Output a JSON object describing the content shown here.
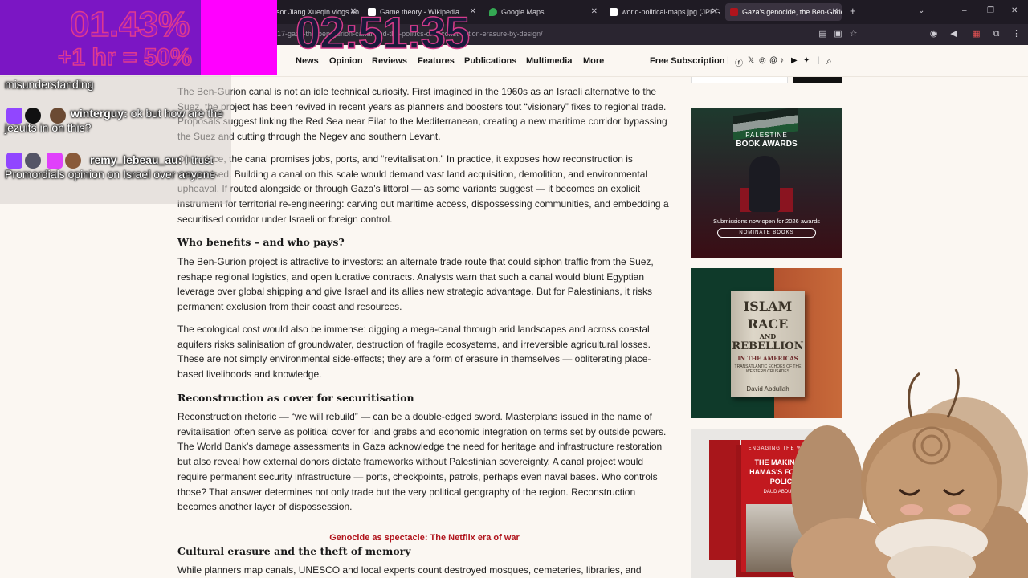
{
  "browser": {
    "tabs": [
      {
        "title": "sor Jiang Xueqin vlogs ab",
        "active": false,
        "fav_color": "#cc2222"
      },
      {
        "title": "Game theory - Wikipedia",
        "active": false,
        "fav_color": "#ffffff"
      },
      {
        "title": "Google Maps",
        "active": false,
        "fav_color": "#34a853"
      },
      {
        "title": "world-political-maps.jpg (JPEG",
        "active": false,
        "fav_color": "#ffffff"
      },
      {
        "title": "Gaza's genocide, the Ben-Gurio",
        "active": true,
        "fav_color": "#b0141c"
      }
    ],
    "url": "917-gaza-the-ben-gurion-canal-and-the-politics-of-reconstruction-erasure-by-design/",
    "new_tab_icon": "plus-icon"
  },
  "site_nav": {
    "links": [
      "News",
      "Opinion",
      "Reviews",
      "Features",
      "Publications",
      "Multimedia",
      "More"
    ],
    "subscription": "Free Subscription",
    "social_icons": [
      "facebook-icon",
      "x-icon",
      "instagram-icon",
      "threads-icon",
      "tiktok-icon",
      "youtube-icon",
      "bluesky-icon"
    ]
  },
  "article": {
    "p1": "The Ben-Gurion canal is not an idle technical curiosity. First imagined in the 1960s as an Israeli alternative to the Suez, the project has been revived in recent years as planners and boosters tout “visionary” fixes to regional trade. Proposals suggest linking the Red Sea near Eilat to the Mediterranean, creating a new maritime corridor bypassing the Suez and cutting through the Negev and southern Levant.",
    "p2": "On its face, the canal promises jobs, ports, and “revitalisation.” In practice, it exposes how reconstruction is weaponised. Building a canal on this scale would demand vast land acquisition, demolition, and environmental upheaval. If routed alongside or through Gaza’s littoral — as some variants suggest — it becomes an explicit instrument for territorial re-engineering: carving out maritime access, dispossessing communities, and embedding a securitised corridor under Israeli or foreign control.",
    "h1": "Who benefits – and who pays?",
    "p3": "The Ben-Gurion project is attractive to investors: an alternate trade route that could siphon traffic from the Suez, reshape regional logistics, and open lucrative contracts. Analysts warn that such a canal would blunt Egyptian leverage over global shipping and give Israel and its allies new strategic advantage. But for Palestinians, it risks permanent exclusion from their coast and resources.",
    "p4": "The ecological cost would also be immense: digging a mega-canal through arid landscapes and across coastal aquifers risks salinisation of groundwater, destruction of fragile ecosystems, and irreversible agricultural losses. These are not simply environmental side-effects; they are a form of erasure in themselves — obliterating place-based livelihoods and knowledge.",
    "h2": "Reconstruction as cover for securitisation",
    "p5": "Reconstruction rhetoric — “we will rebuild” — can be a double-edged sword. Masterplans issued in the name of revitalisation often serve as political cover for land grabs and economic integration on terms set by outside powers. The World Bank’s damage assessments in Gaza acknowledge the need for heritage and infrastructure restoration but also reveal how external donors dictate frameworks without Palestinian sovereignty. A canal project would require permanent security infrastructure — ports, checkpoints, patrols, perhaps even naval bases. Who controls those? That answer determines not only trade but the very political geography of the region. Reconstruction becomes another layer of dispossession.",
    "related": "Genocide as spectacle: The Netflix era of war",
    "h3": "Cultural erasure and the theft of memory",
    "p6": "While planners map canals, UNESCO and local experts count destroyed mosques, cemeteries, libraries, and"
  },
  "sidebar": {
    "ad1": {
      "line1": "PALESTINE",
      "line2": "BOOK AWARDS",
      "line3": "Submissions now open for 2026 awards",
      "button": "NOMINATE BOOKS"
    },
    "ad2": {
      "t1": "ISLAM",
      "t2": "RACE",
      "t3": "AND",
      "t4": "REBELLION",
      "t5": "IN THE AMERICAS",
      "t6": "TRANSATLANTIC ECHOES OF THE WESTERN CRUSADES",
      "t7": "David Abdullah"
    },
    "ad3": {
      "s1": "ENGAGING THE WORLD",
      "s2": "THE MAKING OF HAMAS'S FOREIGN POLICY",
      "s3": "DAUD ABDULLAH"
    }
  },
  "overlay": {
    "percent": "01.43%",
    "bonus": "+1 hr = 50%",
    "timer": "02:51:35",
    "chat": [
      {
        "user": "",
        "text": "misunderstanding"
      },
      {
        "user": "winterguy:",
        "text": "ok but how are the jezuits in on this?"
      },
      {
        "user": "remy_lebeau_au:",
        "text": "I trust Promordials opinion on Israel over anyone"
      }
    ]
  }
}
